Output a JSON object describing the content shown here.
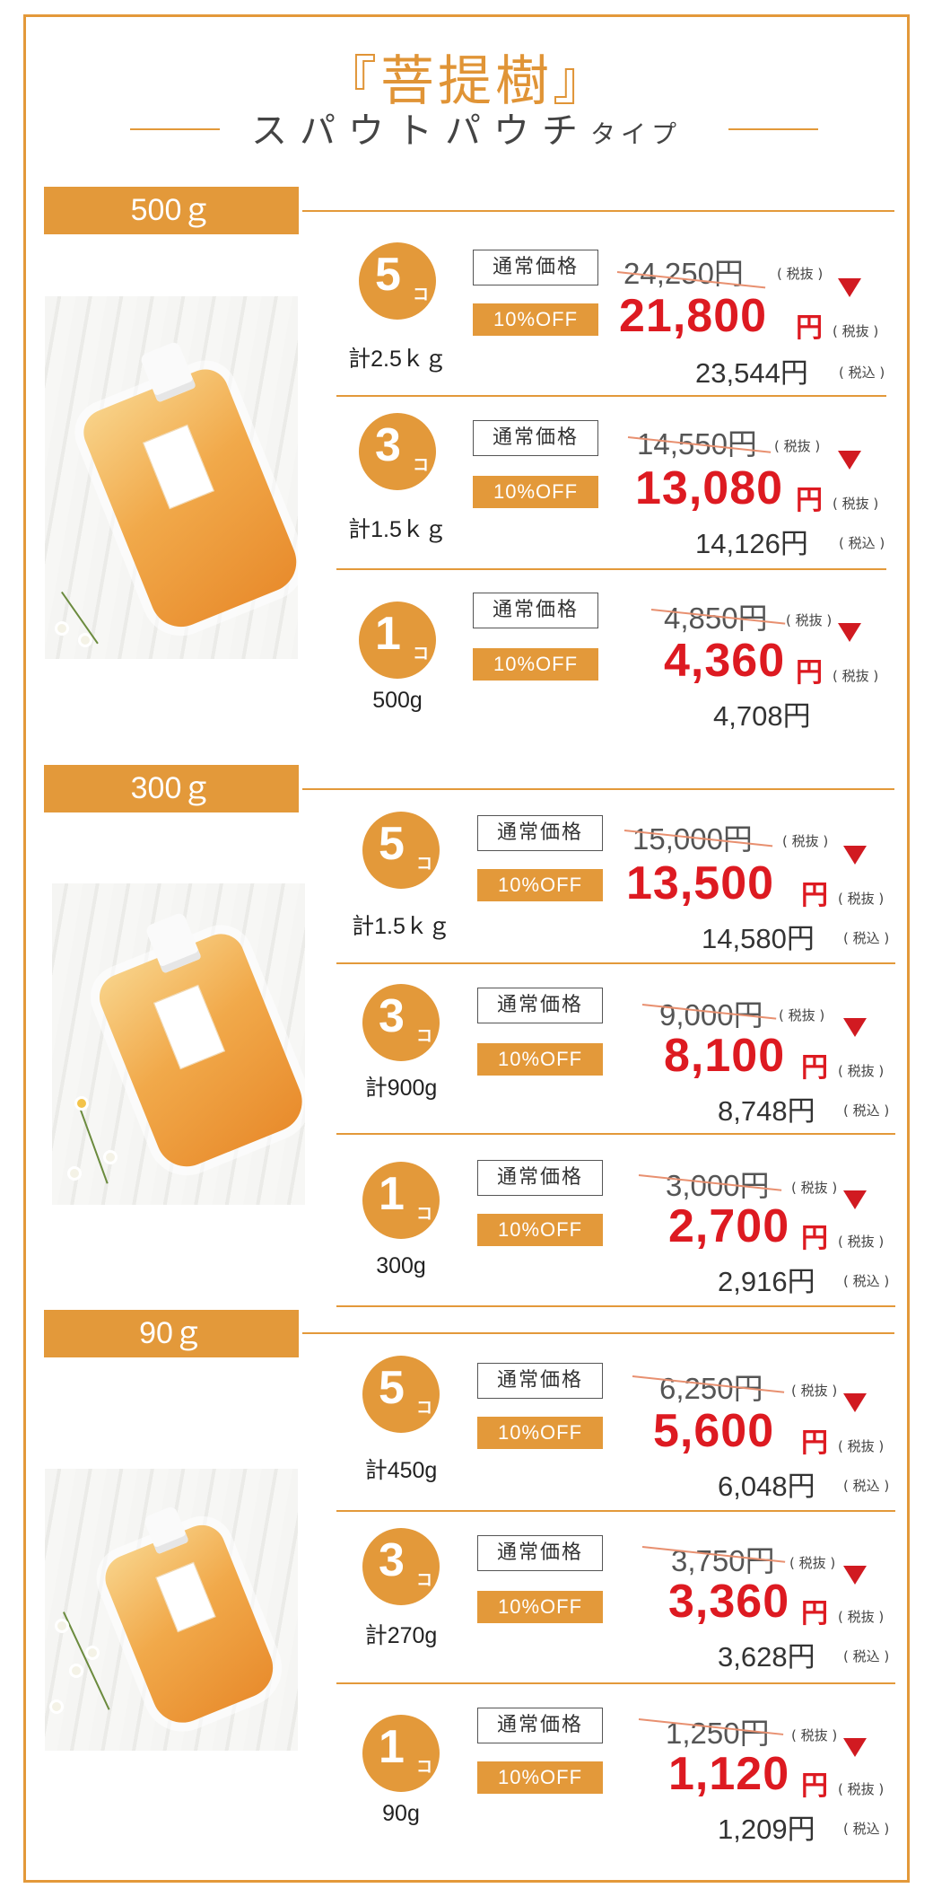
{
  "header": {
    "title": "『菩提樹』",
    "subtitle_main": "スパウトパウチ",
    "subtitle_small": "タイプ"
  },
  "colors": {
    "accent": "#e3993a",
    "sale_red": "#dd1a21"
  },
  "icons": {
    "discount": "triangle-down-icon",
    "product": "spout-pouch-photo"
  },
  "sections": [
    {
      "weight": "500ｇ",
      "rows": [
        {
          "count": "5",
          "unit": "コ",
          "qty": "計2.5ｋｇ",
          "normal_label": "通常価格",
          "off_label": "10%OFF",
          "orig_price": "24,250円",
          "orig_note": "( 税抜 )",
          "sale_price": "21,800",
          "sale_yen": "円",
          "sale_note": "( 税抜 )",
          "incl_price": "23,544円",
          "incl_note": "( 税込 )"
        },
        {
          "count": "3",
          "unit": "コ",
          "qty": "計1.5ｋｇ",
          "normal_label": "通常価格",
          "off_label": "10%OFF",
          "orig_price": "14,550円",
          "orig_note": "( 税抜 )",
          "sale_price": "13,080",
          "sale_yen": "円",
          "sale_note": "( 税抜 )",
          "incl_price": "14,126円",
          "incl_note": "( 税込 )"
        },
        {
          "count": "1",
          "unit": "コ",
          "qty": "500g",
          "normal_label": "通常価格",
          "off_label": "10%OFF",
          "orig_price": "4,850円",
          "orig_note": "( 税抜 )",
          "sale_price": "4,360",
          "sale_yen": "円",
          "sale_note": "( 税抜 )",
          "incl_price": "4,708円",
          "incl_note": ""
        }
      ]
    },
    {
      "weight": "300ｇ",
      "rows": [
        {
          "count": "5",
          "unit": "コ",
          "qty": "計1.5ｋｇ",
          "normal_label": "通常価格",
          "off_label": "10%OFF",
          "orig_price": "15,000円",
          "orig_note": "( 税抜 )",
          "sale_price": "13,500",
          "sale_yen": "円",
          "sale_note": "( 税抜 )",
          "incl_price": "14,580円",
          "incl_note": "( 税込 )"
        },
        {
          "count": "3",
          "unit": "コ",
          "qty": "計900g",
          "normal_label": "通常価格",
          "off_label": "10%OFF",
          "orig_price": "9,000円",
          "orig_note": "( 税抜 )",
          "sale_price": "8,100",
          "sale_yen": "円",
          "sale_note": "( 税抜 )",
          "incl_price": "8,748円",
          "incl_note": "( 税込 )"
        },
        {
          "count": "1",
          "unit": "コ",
          "qty": "300g",
          "normal_label": "通常価格",
          "off_label": "10%OFF",
          "orig_price": "3,000円",
          "orig_note": "( 税抜 )",
          "sale_price": "2,700",
          "sale_yen": "円",
          "sale_note": "( 税抜 )",
          "incl_price": "2,916円",
          "incl_note": "( 税込 )"
        }
      ]
    },
    {
      "weight": "90ｇ",
      "rows": [
        {
          "count": "5",
          "unit": "コ",
          "qty": "計450g",
          "normal_label": "通常価格",
          "off_label": "10%OFF",
          "orig_price": "6,250円",
          "orig_note": "( 税抜 )",
          "sale_price": "5,600",
          "sale_yen": "円",
          "sale_note": "( 税抜 )",
          "incl_price": "6,048円",
          "incl_note": "( 税込 )"
        },
        {
          "count": "3",
          "unit": "コ",
          "qty": "計270g",
          "normal_label": "通常価格",
          "off_label": "10%OFF",
          "orig_price": "3,750円",
          "orig_note": "( 税抜 )",
          "sale_price": "3,360",
          "sale_yen": "円",
          "sale_note": "( 税抜 )",
          "incl_price": "3,628円",
          "incl_note": "( 税込 )"
        },
        {
          "count": "1",
          "unit": "コ",
          "qty": "90g",
          "normal_label": "通常価格",
          "off_label": "10%OFF",
          "orig_price": "1,250円",
          "orig_note": "( 税抜 )",
          "sale_price": "1,120",
          "sale_yen": "円",
          "sale_note": "( 税抜 )",
          "incl_price": "1,209円",
          "incl_note": "( 税込 )"
        }
      ]
    }
  ]
}
